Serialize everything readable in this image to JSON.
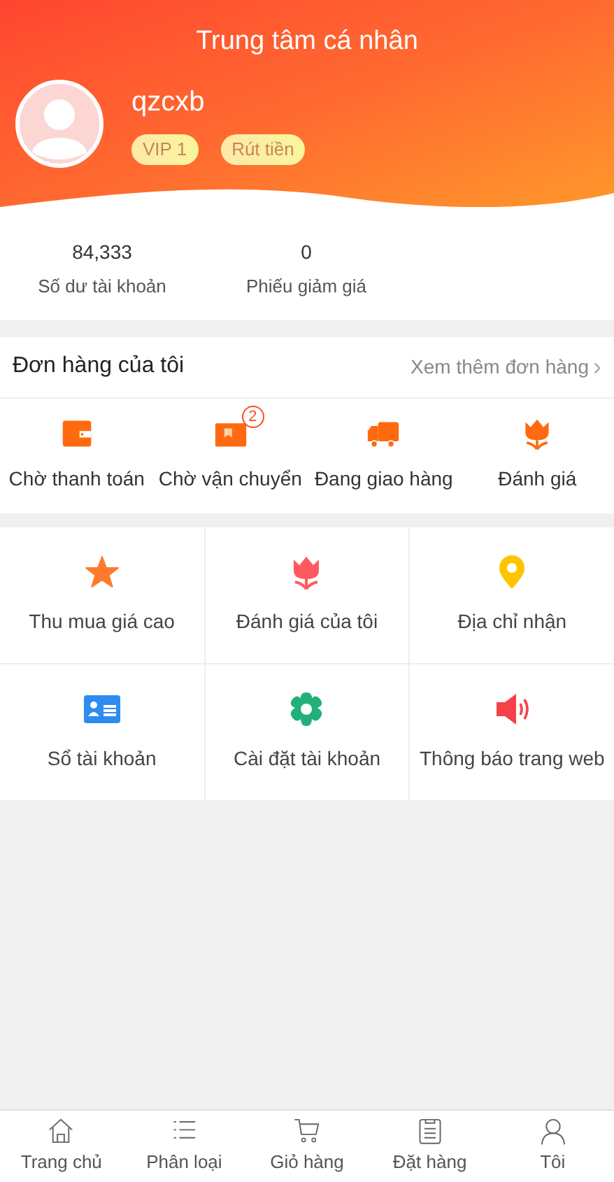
{
  "header": {
    "title": "Trung tâm cá nhân",
    "username": "qzcxb",
    "badges": [
      "VIP 1",
      "Rút tiền"
    ]
  },
  "stats": [
    {
      "value": "84,333",
      "label": "Số dư tài khoản"
    },
    {
      "value": "0",
      "label": "Phiếu giảm giá"
    }
  ],
  "orders": {
    "title": "Đơn hàng của tôi",
    "more": "Xem thêm đơn hàng",
    "more_icon": "›",
    "items": [
      {
        "kind": "wallet",
        "label": "Chờ thanh toán"
      },
      {
        "kind": "box",
        "label": "Chờ vận chuyển",
        "badge": "2"
      },
      {
        "kind": "truck",
        "label": "Đang giao hàng"
      },
      {
        "kind": "flower",
        "label": "Đánh giá"
      }
    ]
  },
  "menu": [
    {
      "kind": "star",
      "label": "Thu mua giá cao"
    },
    {
      "kind": "flower",
      "label": "Đánh giá của tôi"
    },
    {
      "kind": "pin",
      "label": "Địa chỉ nhận"
    },
    {
      "kind": "card",
      "label": "Sổ tài khoản"
    },
    {
      "kind": "gear",
      "label": "Cài đặt tài khoản"
    },
    {
      "kind": "speaker",
      "label": "Thông báo trang web"
    }
  ],
  "tab_bar": [
    {
      "kind": "home",
      "label": "Trang chủ"
    },
    {
      "kind": "list",
      "label": "Phân loại"
    },
    {
      "kind": "cart",
      "label": "Giỏ hàng"
    },
    {
      "kind": "clipboard",
      "label": "Đặt hàng"
    },
    {
      "kind": "user",
      "label": "Tôi"
    }
  ]
}
